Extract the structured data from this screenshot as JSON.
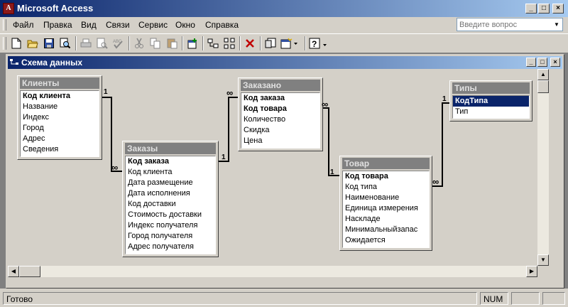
{
  "app": {
    "title": "Microsoft Access"
  },
  "menu": {
    "items": [
      "Файл",
      "Правка",
      "Вид",
      "Связи",
      "Сервис",
      "Окно",
      "Справка"
    ]
  },
  "help": {
    "placeholder": "Введите вопрос"
  },
  "toolbar": {
    "icons": [
      "new-icon",
      "open-icon",
      "save-icon",
      "search-icon",
      "print-icon",
      "print-preview-icon",
      "spelling-icon",
      "cut-icon",
      "copy-icon",
      "paste-icon",
      "show-table-icon",
      "show-direct-icon",
      "show-all-icon",
      "delete-icon",
      "relationships-report-icon",
      "new-object-icon",
      "help-icon"
    ]
  },
  "window": {
    "title": "Схема данных"
  },
  "tables": [
    {
      "title": "Клиенты",
      "fields": [
        "Код клиента",
        "Название",
        "Индекс",
        "Город",
        "Адрес",
        "Сведения"
      ]
    },
    {
      "title": "Заказы",
      "fields": [
        "Код заказа",
        "Код клиента",
        "Дата размещение",
        "Дата исполнения",
        "Код доставки",
        "Стоимость доставки",
        "Индекс получателя",
        "Город получателя",
        "Адрес получателя"
      ]
    },
    {
      "title": "Заказано",
      "fields": [
        "Код заказа",
        "Код товара",
        "Количество",
        "Скидка",
        "Цена"
      ]
    },
    {
      "title": "Товар",
      "fields": [
        "Код товара",
        "Код типа",
        "Наименование",
        "Единица измерения",
        "Наскладе",
        "Минимальныйзапас",
        "Ожидается"
      ]
    },
    {
      "title": "Типы",
      "fields": [
        "КодТипа",
        "Тип"
      ]
    }
  ],
  "relations": {
    "one": "1",
    "many": "∞"
  },
  "status": {
    "text": "Готово",
    "num": "NUM"
  }
}
